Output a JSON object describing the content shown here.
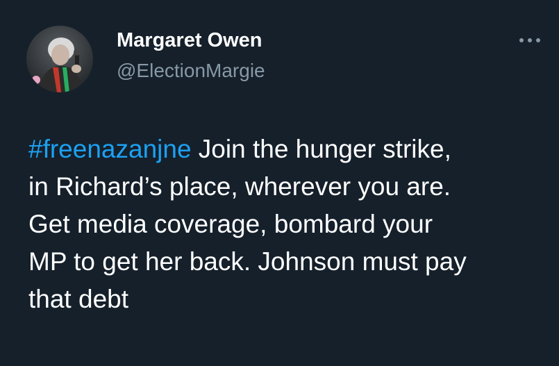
{
  "tweet": {
    "author_name": "Margaret Owen",
    "author_handle": "@ElectionMargie",
    "avatar_icon": "profile-photo",
    "more_icon": "ellipsis-icon",
    "hashtag": "#freenazanjne",
    "lines": [
      " Join the hunger strike,",
      "in Richard’s place, wherever you are.",
      "Get media coverage, bombard your",
      "MP to get her back. Johnson must pay",
      "that debt"
    ]
  },
  "colors": {
    "background": "#15202b",
    "text": "#ffffff",
    "secondary": "#8899a6",
    "link": "#1da1f2"
  }
}
